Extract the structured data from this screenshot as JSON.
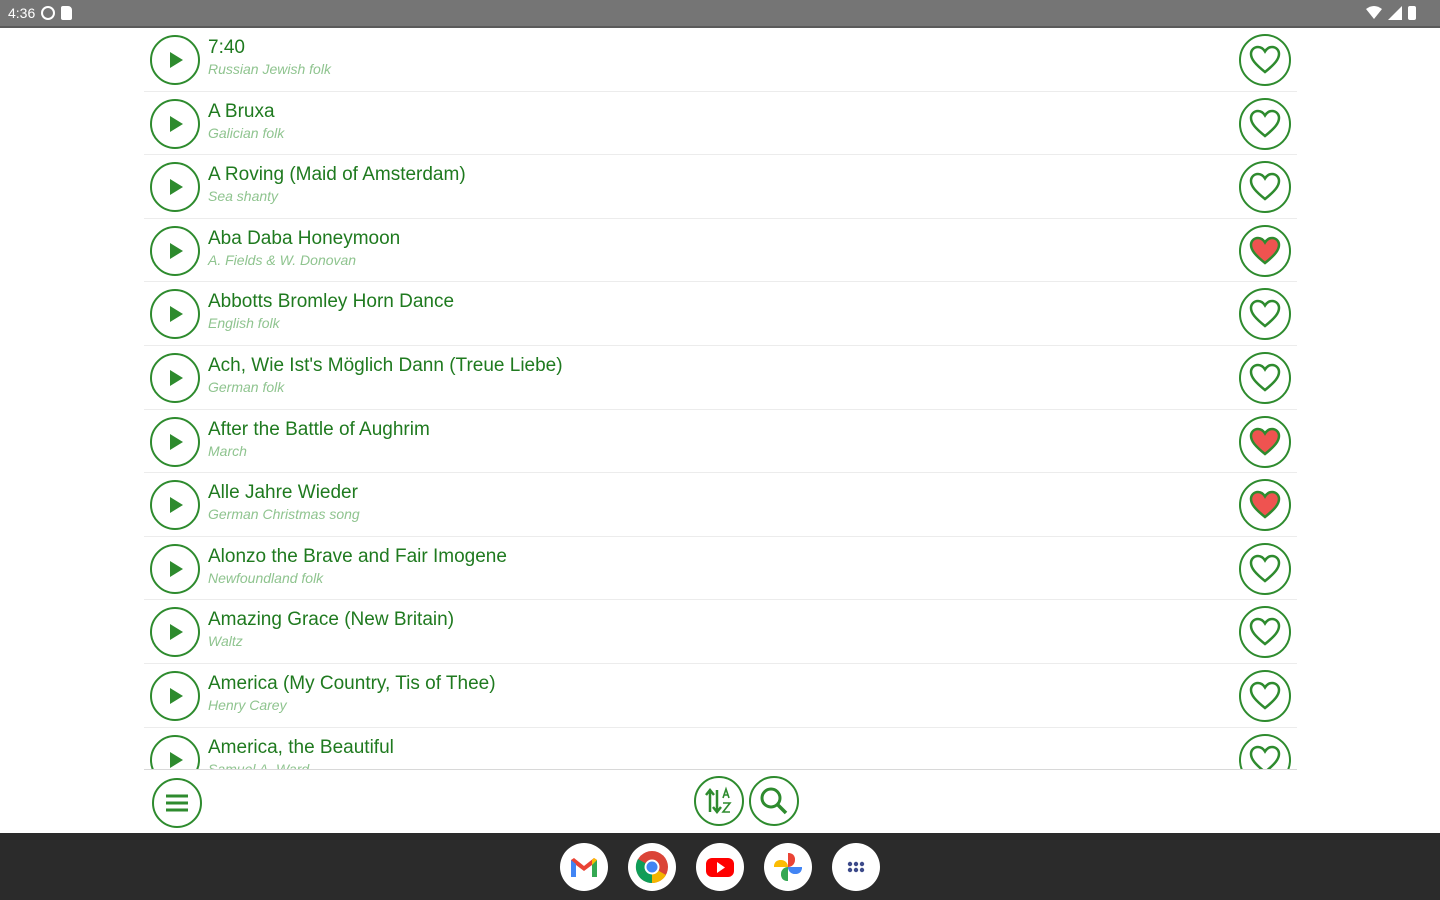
{
  "status_bar": {
    "time": "4:36"
  },
  "songs": [
    {
      "title": "7:40",
      "subtitle": "Russian Jewish folk",
      "favorite": false
    },
    {
      "title": "A Bruxa",
      "subtitle": "Galician folk",
      "favorite": false
    },
    {
      "title": "A Roving (Maid of Amsterdam)",
      "subtitle": "Sea shanty",
      "favorite": false
    },
    {
      "title": "Aba Daba Honeymoon",
      "subtitle": "A. Fields & W. Donovan",
      "favorite": true
    },
    {
      "title": "Abbotts Bromley Horn Dance",
      "subtitle": "English folk",
      "favorite": false
    },
    {
      "title": "Ach, Wie Ist's Möglich Dann (Treue Liebe)",
      "subtitle": "German folk",
      "favorite": false
    },
    {
      "title": "After the Battle of Aughrim",
      "subtitle": "March",
      "favorite": true
    },
    {
      "title": "Alle Jahre Wieder",
      "subtitle": "German Christmas song",
      "favorite": true
    },
    {
      "title": "Alonzo the Brave and Fair Imogene",
      "subtitle": "Newfoundland folk",
      "favorite": false
    },
    {
      "title": "Amazing Grace (New Britain)",
      "subtitle": "Waltz",
      "favorite": false
    },
    {
      "title": "America (My Country, Tis of Thee)",
      "subtitle": "Henry Carey",
      "favorite": false
    },
    {
      "title": "America, the Beautiful",
      "subtitle": "Samuel A. Ward",
      "favorite": false
    }
  ],
  "colors": {
    "accent": "#2e8b2e",
    "title_text": "#1f7a1f",
    "subtitle_text": "#8fc48f",
    "favorite_fill": "#ef5350",
    "status_bar": "#757575",
    "nav_bar": "#2b2b2b"
  },
  "toolbar": {
    "menu_icon": "hamburger-menu-icon",
    "sort_icon": "sort-az-icon",
    "search_icon": "search-icon"
  },
  "dock": [
    {
      "app": "Gmail",
      "icon": "gmail-icon"
    },
    {
      "app": "Chrome",
      "icon": "chrome-icon"
    },
    {
      "app": "YouTube",
      "icon": "youtube-icon"
    },
    {
      "app": "Photos",
      "icon": "photos-icon"
    },
    {
      "app": "App drawer",
      "icon": "app-drawer-icon"
    }
  ]
}
